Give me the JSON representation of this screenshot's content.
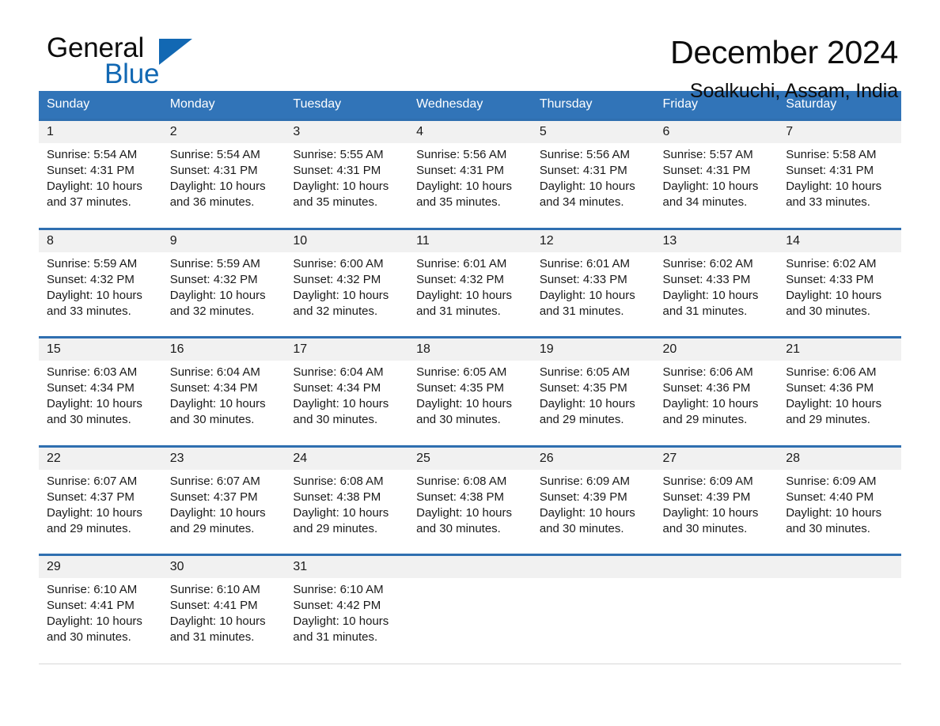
{
  "brand": {
    "line1": "General",
    "line2": "Blue",
    "triangle_color": "#1268b3"
  },
  "header": {
    "title": "December 2024",
    "subtitle": "Soalkuchi, Assam, India"
  },
  "colors": {
    "header_blue": "#3174b8",
    "week_rule_blue": "#2f6fb0",
    "daynum_bg": "#f1f1f1",
    "brand_blue": "#1268b3"
  },
  "weekdays": [
    "Sunday",
    "Monday",
    "Tuesday",
    "Wednesday",
    "Thursday",
    "Friday",
    "Saturday"
  ],
  "weeks": [
    [
      {
        "day": "1",
        "sunrise": "Sunrise: 5:54 AM",
        "sunset": "Sunset: 4:31 PM",
        "daylight1": "Daylight: 10 hours",
        "daylight2": "and 37 minutes."
      },
      {
        "day": "2",
        "sunrise": "Sunrise: 5:54 AM",
        "sunset": "Sunset: 4:31 PM",
        "daylight1": "Daylight: 10 hours",
        "daylight2": "and 36 minutes."
      },
      {
        "day": "3",
        "sunrise": "Sunrise: 5:55 AM",
        "sunset": "Sunset: 4:31 PM",
        "daylight1": "Daylight: 10 hours",
        "daylight2": "and 35 minutes."
      },
      {
        "day": "4",
        "sunrise": "Sunrise: 5:56 AM",
        "sunset": "Sunset: 4:31 PM",
        "daylight1": "Daylight: 10 hours",
        "daylight2": "and 35 minutes."
      },
      {
        "day": "5",
        "sunrise": "Sunrise: 5:56 AM",
        "sunset": "Sunset: 4:31 PM",
        "daylight1": "Daylight: 10 hours",
        "daylight2": "and 34 minutes."
      },
      {
        "day": "6",
        "sunrise": "Sunrise: 5:57 AM",
        "sunset": "Sunset: 4:31 PM",
        "daylight1": "Daylight: 10 hours",
        "daylight2": "and 34 minutes."
      },
      {
        "day": "7",
        "sunrise": "Sunrise: 5:58 AM",
        "sunset": "Sunset: 4:31 PM",
        "daylight1": "Daylight: 10 hours",
        "daylight2": "and 33 minutes."
      }
    ],
    [
      {
        "day": "8",
        "sunrise": "Sunrise: 5:59 AM",
        "sunset": "Sunset: 4:32 PM",
        "daylight1": "Daylight: 10 hours",
        "daylight2": "and 33 minutes."
      },
      {
        "day": "9",
        "sunrise": "Sunrise: 5:59 AM",
        "sunset": "Sunset: 4:32 PM",
        "daylight1": "Daylight: 10 hours",
        "daylight2": "and 32 minutes."
      },
      {
        "day": "10",
        "sunrise": "Sunrise: 6:00 AM",
        "sunset": "Sunset: 4:32 PM",
        "daylight1": "Daylight: 10 hours",
        "daylight2": "and 32 minutes."
      },
      {
        "day": "11",
        "sunrise": "Sunrise: 6:01 AM",
        "sunset": "Sunset: 4:32 PM",
        "daylight1": "Daylight: 10 hours",
        "daylight2": "and 31 minutes."
      },
      {
        "day": "12",
        "sunrise": "Sunrise: 6:01 AM",
        "sunset": "Sunset: 4:33 PM",
        "daylight1": "Daylight: 10 hours",
        "daylight2": "and 31 minutes."
      },
      {
        "day": "13",
        "sunrise": "Sunrise: 6:02 AM",
        "sunset": "Sunset: 4:33 PM",
        "daylight1": "Daylight: 10 hours",
        "daylight2": "and 31 minutes."
      },
      {
        "day": "14",
        "sunrise": "Sunrise: 6:02 AM",
        "sunset": "Sunset: 4:33 PM",
        "daylight1": "Daylight: 10 hours",
        "daylight2": "and 30 minutes."
      }
    ],
    [
      {
        "day": "15",
        "sunrise": "Sunrise: 6:03 AM",
        "sunset": "Sunset: 4:34 PM",
        "daylight1": "Daylight: 10 hours",
        "daylight2": "and 30 minutes."
      },
      {
        "day": "16",
        "sunrise": "Sunrise: 6:04 AM",
        "sunset": "Sunset: 4:34 PM",
        "daylight1": "Daylight: 10 hours",
        "daylight2": "and 30 minutes."
      },
      {
        "day": "17",
        "sunrise": "Sunrise: 6:04 AM",
        "sunset": "Sunset: 4:34 PM",
        "daylight1": "Daylight: 10 hours",
        "daylight2": "and 30 minutes."
      },
      {
        "day": "18",
        "sunrise": "Sunrise: 6:05 AM",
        "sunset": "Sunset: 4:35 PM",
        "daylight1": "Daylight: 10 hours",
        "daylight2": "and 30 minutes."
      },
      {
        "day": "19",
        "sunrise": "Sunrise: 6:05 AM",
        "sunset": "Sunset: 4:35 PM",
        "daylight1": "Daylight: 10 hours",
        "daylight2": "and 29 minutes."
      },
      {
        "day": "20",
        "sunrise": "Sunrise: 6:06 AM",
        "sunset": "Sunset: 4:36 PM",
        "daylight1": "Daylight: 10 hours",
        "daylight2": "and 29 minutes."
      },
      {
        "day": "21",
        "sunrise": "Sunrise: 6:06 AM",
        "sunset": "Sunset: 4:36 PM",
        "daylight1": "Daylight: 10 hours",
        "daylight2": "and 29 minutes."
      }
    ],
    [
      {
        "day": "22",
        "sunrise": "Sunrise: 6:07 AM",
        "sunset": "Sunset: 4:37 PM",
        "daylight1": "Daylight: 10 hours",
        "daylight2": "and 29 minutes."
      },
      {
        "day": "23",
        "sunrise": "Sunrise: 6:07 AM",
        "sunset": "Sunset: 4:37 PM",
        "daylight1": "Daylight: 10 hours",
        "daylight2": "and 29 minutes."
      },
      {
        "day": "24",
        "sunrise": "Sunrise: 6:08 AM",
        "sunset": "Sunset: 4:38 PM",
        "daylight1": "Daylight: 10 hours",
        "daylight2": "and 29 minutes."
      },
      {
        "day": "25",
        "sunrise": "Sunrise: 6:08 AM",
        "sunset": "Sunset: 4:38 PM",
        "daylight1": "Daylight: 10 hours",
        "daylight2": "and 30 minutes."
      },
      {
        "day": "26",
        "sunrise": "Sunrise: 6:09 AM",
        "sunset": "Sunset: 4:39 PM",
        "daylight1": "Daylight: 10 hours",
        "daylight2": "and 30 minutes."
      },
      {
        "day": "27",
        "sunrise": "Sunrise: 6:09 AM",
        "sunset": "Sunset: 4:39 PM",
        "daylight1": "Daylight: 10 hours",
        "daylight2": "and 30 minutes."
      },
      {
        "day": "28",
        "sunrise": "Sunrise: 6:09 AM",
        "sunset": "Sunset: 4:40 PM",
        "daylight1": "Daylight: 10 hours",
        "daylight2": "and 30 minutes."
      }
    ],
    [
      {
        "day": "29",
        "sunrise": "Sunrise: 6:10 AM",
        "sunset": "Sunset: 4:41 PM",
        "daylight1": "Daylight: 10 hours",
        "daylight2": "and 30 minutes."
      },
      {
        "day": "30",
        "sunrise": "Sunrise: 6:10 AM",
        "sunset": "Sunset: 4:41 PM",
        "daylight1": "Daylight: 10 hours",
        "daylight2": "and 31 minutes."
      },
      {
        "day": "31",
        "sunrise": "Sunrise: 6:10 AM",
        "sunset": "Sunset: 4:42 PM",
        "daylight1": "Daylight: 10 hours",
        "daylight2": "and 31 minutes."
      },
      null,
      null,
      null,
      null
    ]
  ]
}
